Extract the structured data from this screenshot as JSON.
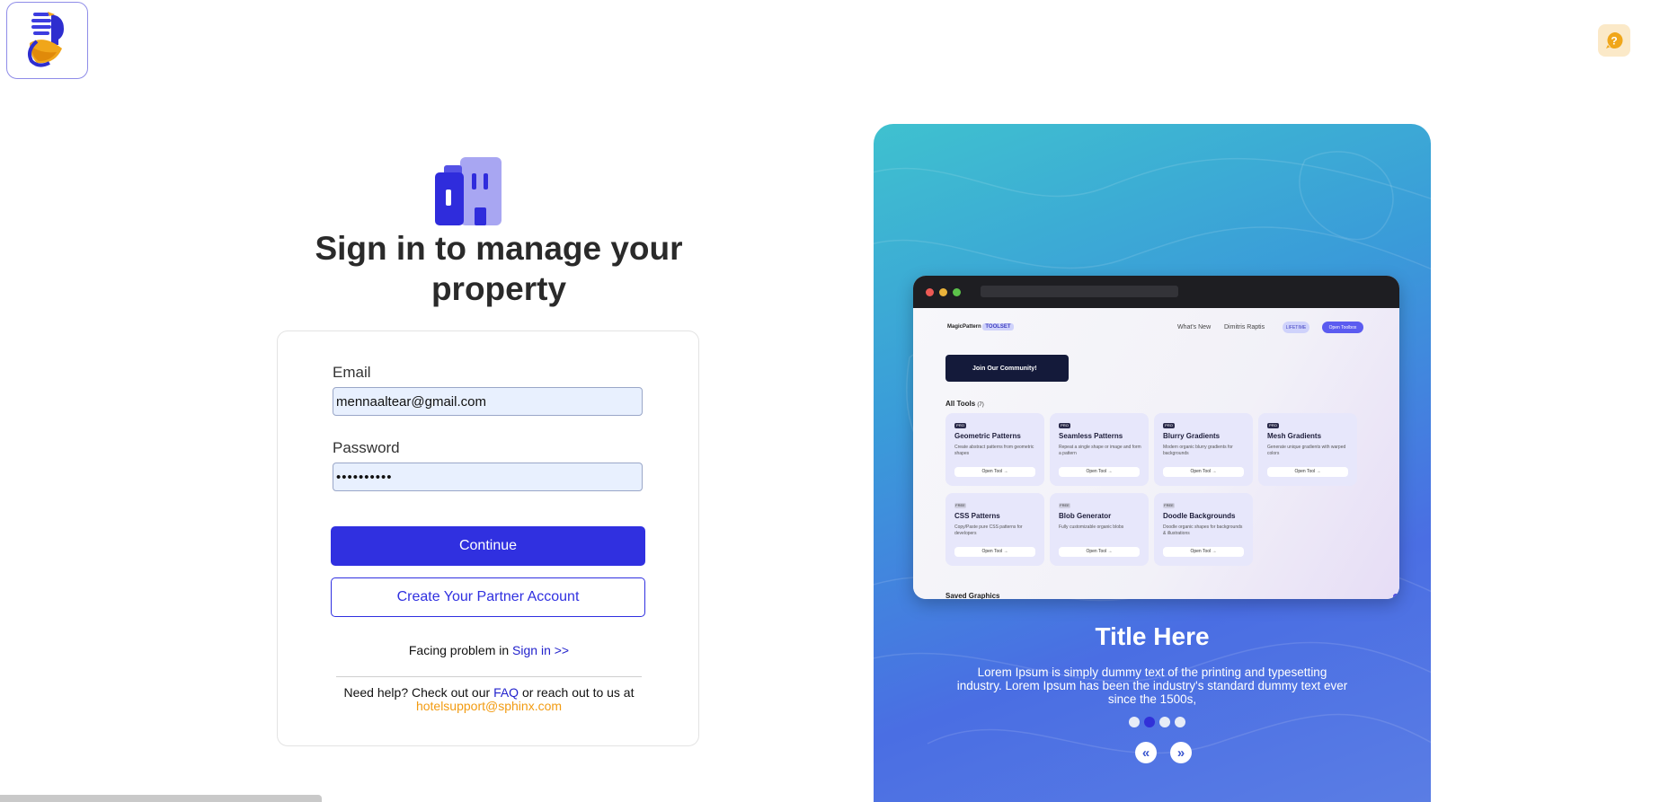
{
  "colors": {
    "primary": "#3030e0",
    "link_orange": "#f29b11",
    "help_bg": "#fbe9c8",
    "help_icon": "#f0a61a"
  },
  "header": {
    "logo_icon": "sphinx-logo-icon",
    "help_icon": "question-icon",
    "help_symbol": "?"
  },
  "signin": {
    "heading": "Sign in to manage your property",
    "hero_icon": "building-icon",
    "email_label": "Email",
    "email_value": "mennaaltear@gmail.com",
    "password_label": "Password",
    "password_value": "••••••••••",
    "continue_label": "Continue",
    "create_account_label": "Create Your Partner Account",
    "problem_text": "Facing problem in",
    "problem_link": "Sign in >>",
    "help_prefix": "Need help? Check out our",
    "faq_link": "FAQ",
    "help_middle": "or reach out to us at",
    "support_email": "hotelsupport@sphinx.com"
  },
  "promo": {
    "title": "Title Here",
    "text": "Lorem Ipsum is simply dummy text of the printing and typesetting industry. Lorem Ipsum has been the industry's standard dummy text ever since the 1500s,",
    "active_slide": 2,
    "slide_count": 4,
    "prev_symbol": "«",
    "next_symbol": "»",
    "mock": {
      "brand": "MagicPattern",
      "brand_badge": "TOOLSET",
      "nav_whats_new": "What's New",
      "nav_user": "Dimitris Raptis",
      "lifetime_badge": "LIFETIME",
      "open_toolbox": "Open Toolbox",
      "community": "Join Our Community!",
      "all_tools": "All Tools",
      "all_tools_count": "(7)",
      "saved": "Saved Graphics",
      "open_tool": "Open Tool →",
      "tools": [
        {
          "badge": "PRO",
          "name": "Geometric Patterns",
          "desc": "Create abstract patterns from geometric shapes"
        },
        {
          "badge": "PRO",
          "name": "Seamless Patterns",
          "desc": "Repeat a single shape or image and form a pattern"
        },
        {
          "badge": "PRO",
          "name": "Blurry Gradients",
          "desc": "Modern organic blurry gradients for backgrounds"
        },
        {
          "badge": "PRO",
          "name": "Mesh Gradients",
          "desc": "Generate unique gradients with warped colors"
        },
        {
          "badge": "FREE",
          "name": "CSS Patterns",
          "desc": "Copy/Paste pure CSS patterns for developers"
        },
        {
          "badge": "FREE",
          "name": "Blob Generator",
          "desc": "Fully customizable organic blobs"
        },
        {
          "badge": "FREE",
          "name": "Doodle Backgrounds",
          "desc": "Doodle organic shapes for backgrounds & illustrations"
        }
      ]
    }
  }
}
